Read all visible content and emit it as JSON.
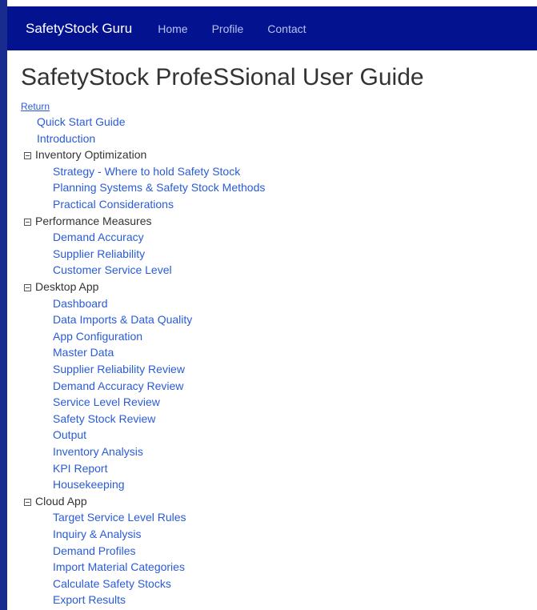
{
  "nav": {
    "brand": "SafetyStock Guru",
    "links": [
      "Home",
      "Profile",
      "Contact"
    ]
  },
  "page": {
    "title": "SafetyStock ProfeSSional User Guide",
    "return_label": "Return"
  },
  "toc": {
    "top_items": [
      "Quick Start Guide",
      "Introduction"
    ],
    "sections": [
      {
        "label": "Inventory Optimization",
        "items": [
          "Strategy - Where to hold Safety Stock",
          "Planning Systems & Safety Stock Methods",
          "Practical Considerations"
        ]
      },
      {
        "label": "Performance Measures",
        "items": [
          "Demand Accuracy",
          "Supplier Reliability",
          "Customer Service Level"
        ]
      },
      {
        "label": "Desktop App",
        "items": [
          "Dashboard",
          "Data Imports & Data Quality",
          "App Configuration",
          "Master Data",
          "Supplier Reliability Review",
          "Demand Accuracy Review",
          "Service Level Review",
          "Safety Stock Review",
          "Output",
          "Inventory Analysis",
          "KPI Report",
          "Housekeeping"
        ]
      },
      {
        "label": "Cloud App",
        "items": [
          "Target Service Level Rules",
          "Inquiry & Analysis",
          "Demand Profiles",
          "Import Material Categories",
          "Calculate Safety Stocks",
          "Export Results"
        ]
      }
    ]
  }
}
